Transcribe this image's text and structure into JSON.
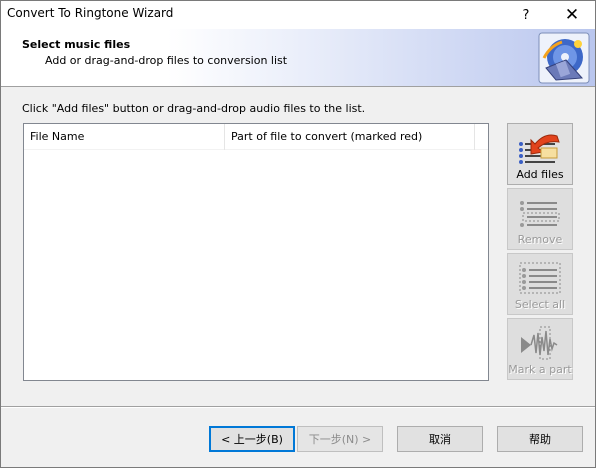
{
  "window": {
    "title": "Convert To Ringtone Wizard",
    "help_glyph": "?",
    "close_glyph": "✕"
  },
  "header": {
    "title": "Select music files",
    "subtitle": "Add or drag-and-drop files to conversion list",
    "icon": "wizard-disc-icon"
  },
  "instruction": "Click \"Add files\" button or drag-and-drop audio files to the list.",
  "list": {
    "columns": [
      "File Name",
      "Part of file to convert (marked red)"
    ],
    "rows": []
  },
  "side_buttons": [
    {
      "label": "Add files",
      "icon": "add-files-icon",
      "enabled": true
    },
    {
      "label": "Remove",
      "icon": "remove-icon",
      "enabled": false
    },
    {
      "label": "Select all",
      "icon": "select-all-icon",
      "enabled": false
    },
    {
      "label": "Mark a part",
      "icon": "mark-part-icon",
      "enabled": false
    }
  ],
  "footer": {
    "back": "< 上一步(B)",
    "next": "下一步(N) >",
    "cancel": "取消",
    "help": "帮助"
  },
  "colors": {
    "accent_border": "#0078d7",
    "header_gradient_end": "#b9c6ee"
  }
}
